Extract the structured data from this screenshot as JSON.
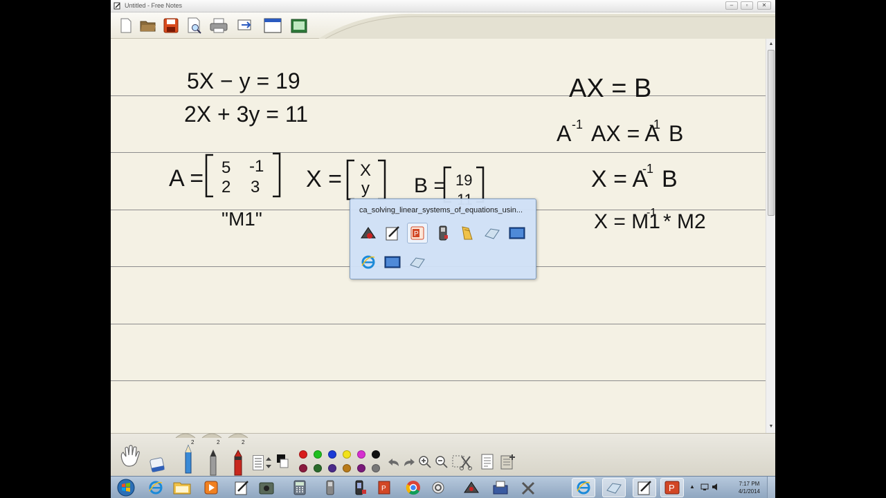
{
  "window": {
    "title": "Untitled - Free Notes",
    "controls": {
      "minimize": "–",
      "maximize": "▫",
      "close": "✕"
    }
  },
  "toolbar": {
    "buttons": [
      "new-icon",
      "open-icon",
      "save-icon",
      "print-preview-icon",
      "print-icon",
      "export-icon",
      "window-icon",
      "screenshot-icon"
    ]
  },
  "notes": {
    "equation1": "5X − y = 19",
    "equation2": "2X + 3y = 11",
    "matrix_A_label": "A =",
    "matrix_A": [
      "5",
      "-1",
      "2",
      "3"
    ],
    "matrix_X_label": "X =",
    "matrix_X": [
      "X",
      "y"
    ],
    "matrix_B_label": "B =",
    "matrix_B": [
      "19",
      "11"
    ],
    "m1_label": "\"M1\"",
    "formula1": "AX = B",
    "formula2_base": "A",
    "formula2_rest": "AX = A",
    "formula2_end": "B",
    "formula3_start": "X = A",
    "formula3_end": "B",
    "formula4_start": "X = M1",
    "formula4_end": "* M2",
    "superscript": "-1"
  },
  "popup": {
    "title": "ca_solving_linear_systems_of_equations_usin...",
    "row1": [
      "webcam-icon",
      "notes-icon",
      "powerpoint-icon",
      "calculator-icon",
      "folder-icon",
      "eraser-board-icon",
      "screen-icon"
    ],
    "row2": [
      "ie-icon",
      "screen-icon",
      "eraser-board-icon"
    ]
  },
  "palette": {
    "widths": [
      "2",
      "2",
      "2"
    ],
    "colors_row1": [
      "#d81c1c",
      "#1fbf1f",
      "#1a3ad6",
      "#f2e21a",
      "#d62fd0",
      "#111111"
    ],
    "colors_row2": [
      "#8a1a3e",
      "#2a6a2a",
      "#4a2a8a",
      "#b87a18",
      "#7a1a7a",
      "#777777"
    ]
  },
  "taskbar": {
    "time": "7:17 PM",
    "date": "4/1/2014"
  }
}
